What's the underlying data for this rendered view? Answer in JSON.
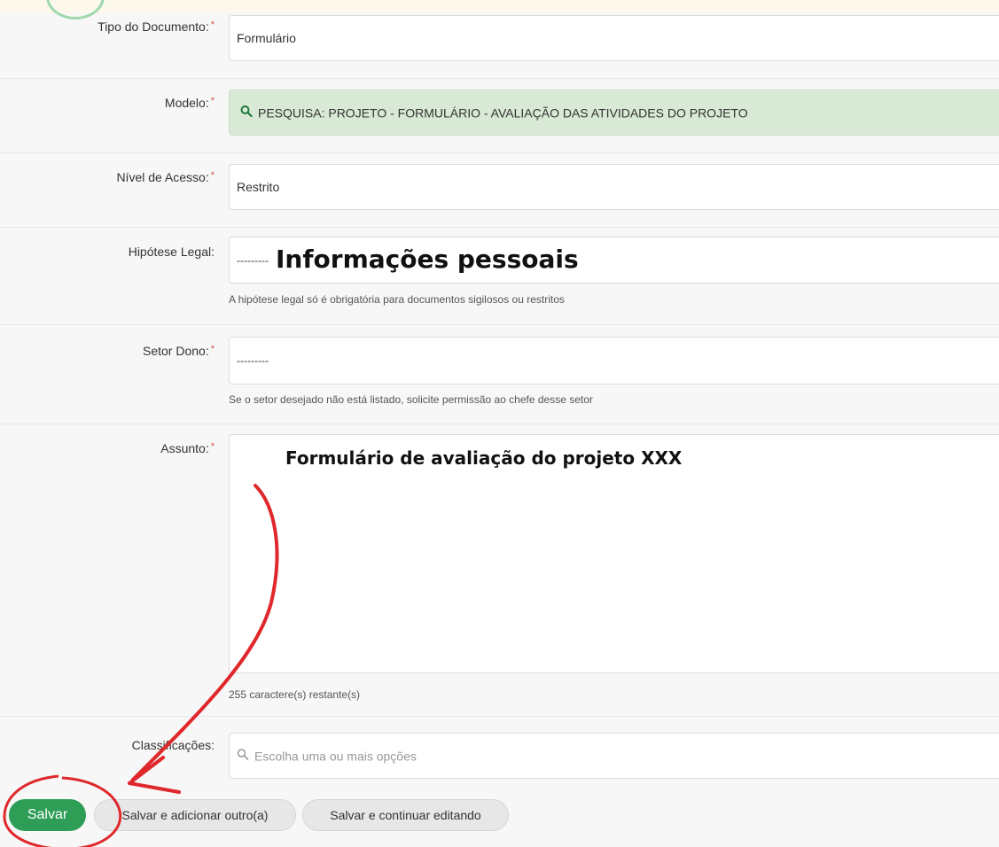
{
  "form": {
    "tipo_label": "Tipo do Documento:",
    "tipo_value": "Formulário",
    "modelo_label": "Modelo:",
    "modelo_value": "PESQUISA: PROJETO - FORMULÁRIO - AVALIAÇÃO DAS ATIVIDADES DO PROJETO",
    "nivel_label": "Nível de Acesso:",
    "nivel_value": "Restrito",
    "hipotese_label": "Hipótese Legal:",
    "hipotese_value": "---------",
    "hipotese_help": "A hipótese legal só é obrigatória para documentos sigilosos ou restritos",
    "setor_label": "Setor Dono:",
    "setor_value": "---------",
    "setor_help": "Se o setor desejado não está listado, solicite permissão ao chefe desse setor",
    "assunto_label": "Assunto:",
    "assunto_help": "255 caractere(s) restante(s)",
    "classificacoes_label": "Classificações:",
    "classificacoes_placeholder": "Escolha uma ou mais opções",
    "required_mark": "*"
  },
  "overlay": {
    "hipotese_text": "Informações pessoais",
    "assunto_text": "Formulário de avaliação do projeto XXX"
  },
  "buttons": {
    "salvar": "Salvar",
    "salvar_adicionar": "Salvar e adicionar outro(a)",
    "salvar_continuar": "Salvar e continuar editando"
  },
  "colors": {
    "primary_button": "#2e9e57",
    "model_field_bg": "#d8ead5",
    "annotation_red": "#e0272b",
    "required_star": "#d9534f"
  },
  "icons": {
    "model_search": "search-icon",
    "classificacoes_search": "search-icon"
  }
}
